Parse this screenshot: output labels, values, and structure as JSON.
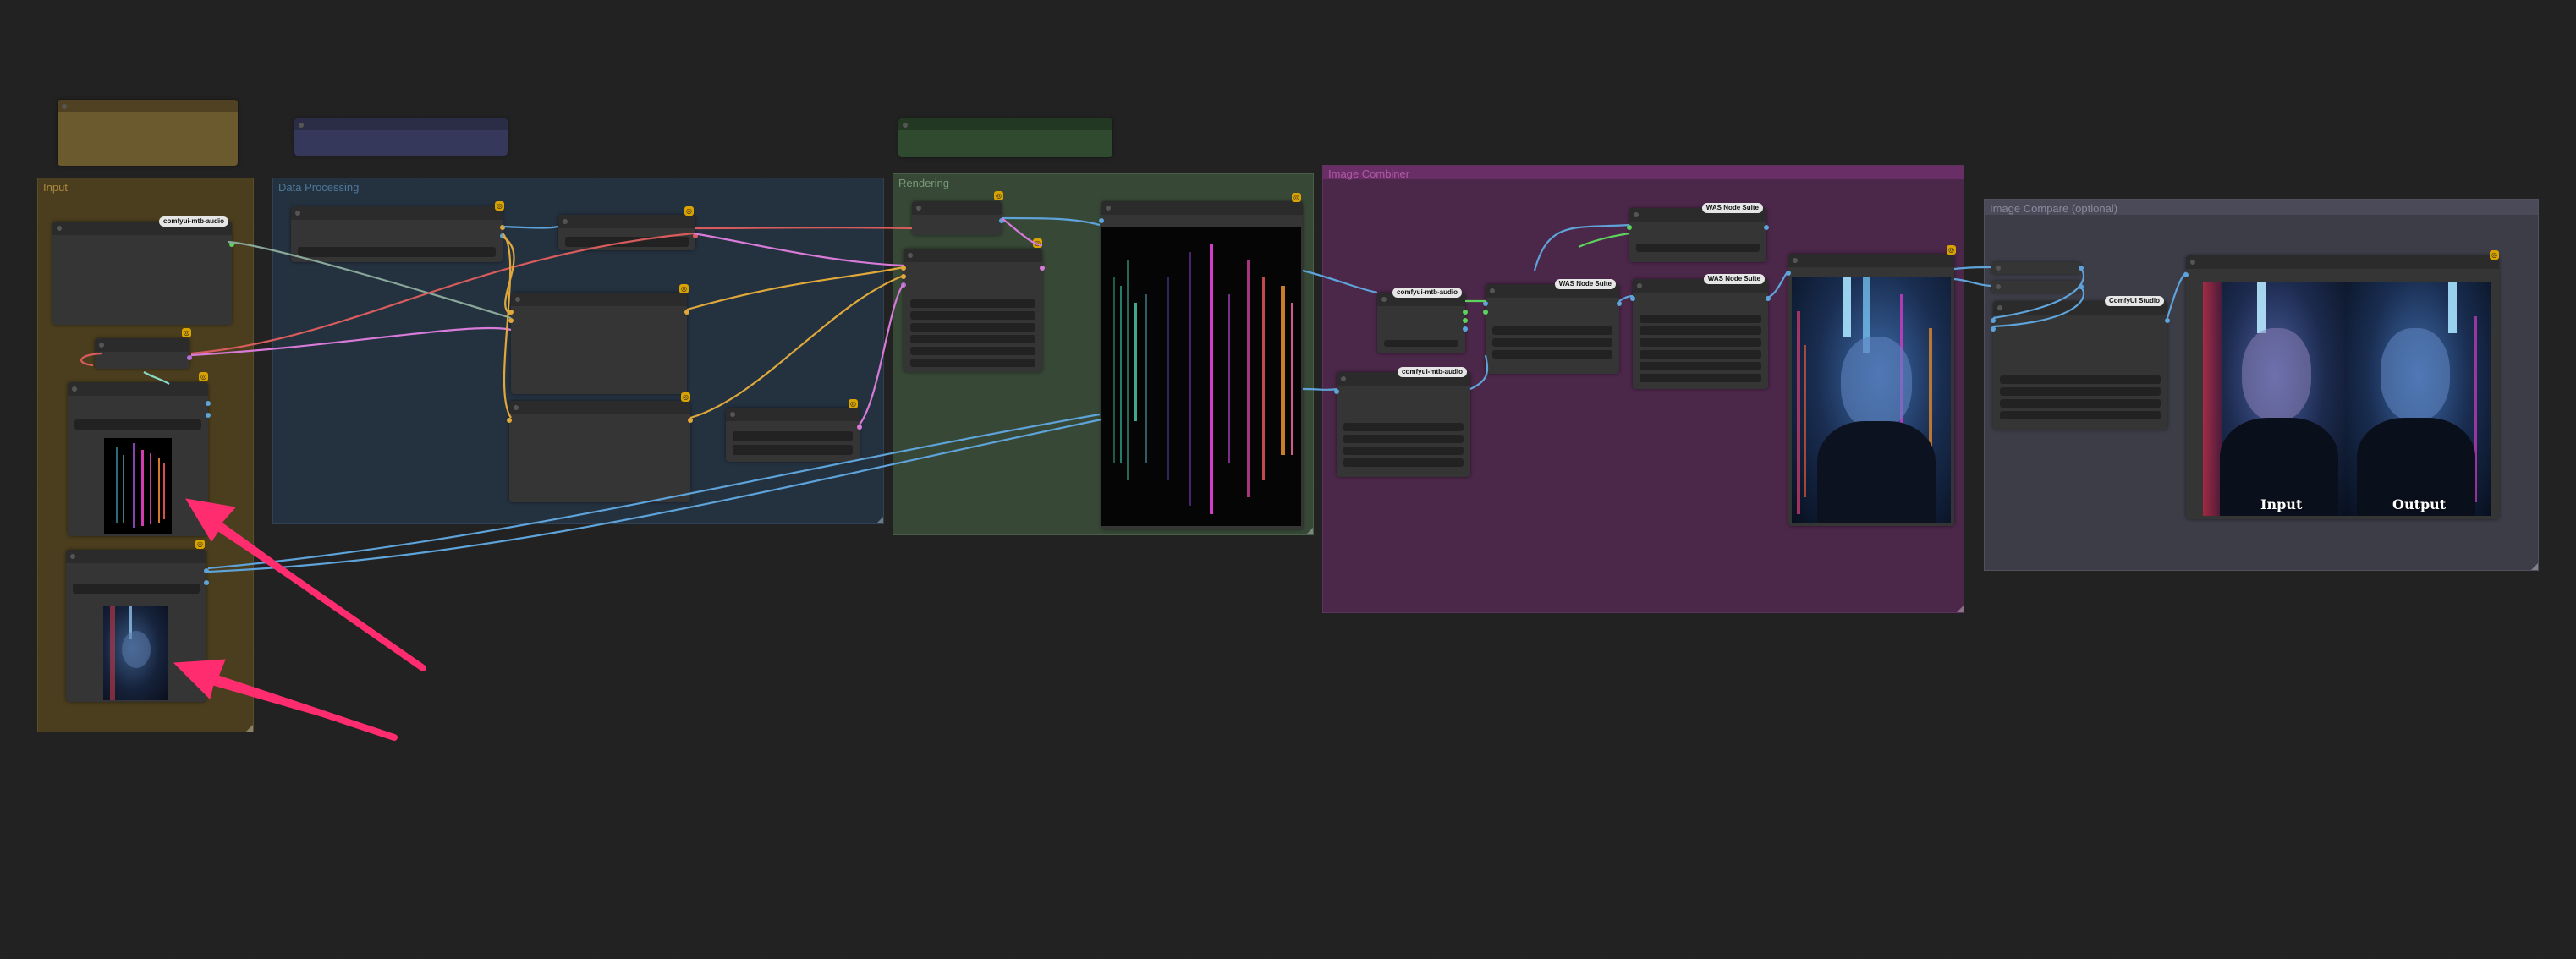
{
  "groups": [
    {
      "id": "input",
      "title": "Input",
      "color": "#4a3e1e"
    },
    {
      "id": "data-processing",
      "title": "Data Processing",
      "color": "#243240"
    },
    {
      "id": "rendering",
      "title": "Rendering",
      "color": "#374837"
    },
    {
      "id": "image-combiner",
      "title": "Image Combiner",
      "color": "#4b2749"
    },
    {
      "id": "image-compare",
      "title": "Image Compare (optional)",
      "color": "#3d3d48"
    }
  ],
  "badges": {
    "comfyui_audio_1": "comfyui-mtb-audio",
    "comfyui_audio_2": "comfyui-mtb-audio",
    "comfyui_audio_3": "comfyui-mtb-audio",
    "was_suite_1": "WAS Node Suite",
    "was_suite_2": "WAS Node Suite",
    "was_suite_3": "WAS Node Suite",
    "comfyroll": "ComfyUI Studio"
  },
  "compare": {
    "left_label": "Input",
    "right_label": "Output"
  },
  "colors": {
    "link_blue": "#5ea3d9",
    "link_yellow": "#e0a83a",
    "link_pink": "#d8739a",
    "link_purple": "#b36fd8",
    "link_red": "#d85c5c",
    "arrow": "#ff2d70"
  },
  "icons": {
    "pin": "pin-icon",
    "arrow": "annotation-arrow"
  }
}
